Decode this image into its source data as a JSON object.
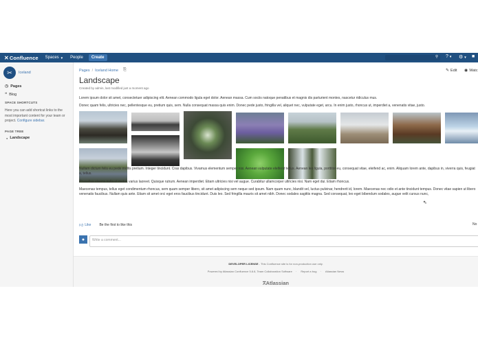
{
  "header": {
    "logo": "Confluence",
    "nav": {
      "spaces": "Spaces",
      "people": "People",
      "create": "Create"
    }
  },
  "sidebar": {
    "space_name": "Iceland",
    "pages": "Pages",
    "blog": "Blog",
    "shortcuts_heading": "SPACE SHORTCUTS",
    "shortcuts_text": "Here you can add shortcut links to the most important content for your team or project.",
    "configure_link": "Configure sidebar.",
    "page_tree_heading": "PAGE TREE",
    "tree_item": "Landscape"
  },
  "breadcrumbs": {
    "pages": "Pages",
    "sep": "/",
    "parent": "Iceland Home"
  },
  "actions": {
    "edit": "Edit",
    "watch": "Watc"
  },
  "page": {
    "title": "Landscape",
    "meta": "Created by admin, last modified just a moment ago",
    "p1": "Lorem ipsum dolor sit amet, consectetuer adipiscing elit. Aenean commodo ligula eget dolor. Aenean massa. Cum sociis natoque penatibus et magnis dis parturient montes, nascetur ridiculus mus.",
    "p2": "Donec quam felis, ultricies nec, pellentesque eu, pretium quis, sem. Nulla consequat massa quis enim. Donec pede justo, fringilla vel, aliquet nec, vulputate eget, arcu. In enim justo, rhoncus ut, imperdiet a, venenatis vitae, justo.",
    "p3": "Nullam dictum felis eu pede mollis pretium. Integer tincidunt. Cras dapibus. Vivamus elementum semper nisi. Aenean vulputate eleifend tellus. Aenean leo ligula, porttitor eu, consequat vitae, eleifend ac, enim. Aliquam lorem ante, dapibus in, viverra quis, feugiat a, tellus.",
    "p4": "Phasellus viverra nulla ut metus varius laoreet. Quisque rutrum. Aenean imperdiet. Etiam ultricies nisi vel augue. Curabitur ullamcorper ultricies nisi. Nam eget dui. Etiam rhoncus.",
    "p5": "Maecenas tempus, tellus eget condimentum rhoncus, sem quam semper libero, sit amet adipiscing sem neque sed ipsum. Nam quam nunc, blandit vel, luctus pulvinar, hendrerit id, lorem. Maecenas nec odio et ante tincidunt tempus. Donec vitae sapien ut libero venenatis faucibus. Nullam quis ante. Etiam sit amet orci eget eros faucibus tincidunt. Duis leo. Sed fringilla mauris sit amet nibh. Donec sodales sagittis magna. Sed consequat, leo eget bibendum sodales, augue velit cursus nunc,"
  },
  "like": {
    "button": "Like",
    "text": "Be the first to like this",
    "labels": "No"
  },
  "comment": {
    "placeholder": "Write a comment..."
  },
  "footer": {
    "license_bold": "DEVELOPER LICENSE",
    "license_rest": " - This Confluence site is for non-production use only.",
    "powered": "Powered by Atlassian Confluence 5.8.8, Team Collaboration Software",
    "report": "Report a bug",
    "news": "Atlassian News",
    "brand": "Atlassian"
  },
  "colors": {
    "header": "#205081",
    "link": "#3b73af",
    "sidebar": "#f5f5f5"
  }
}
